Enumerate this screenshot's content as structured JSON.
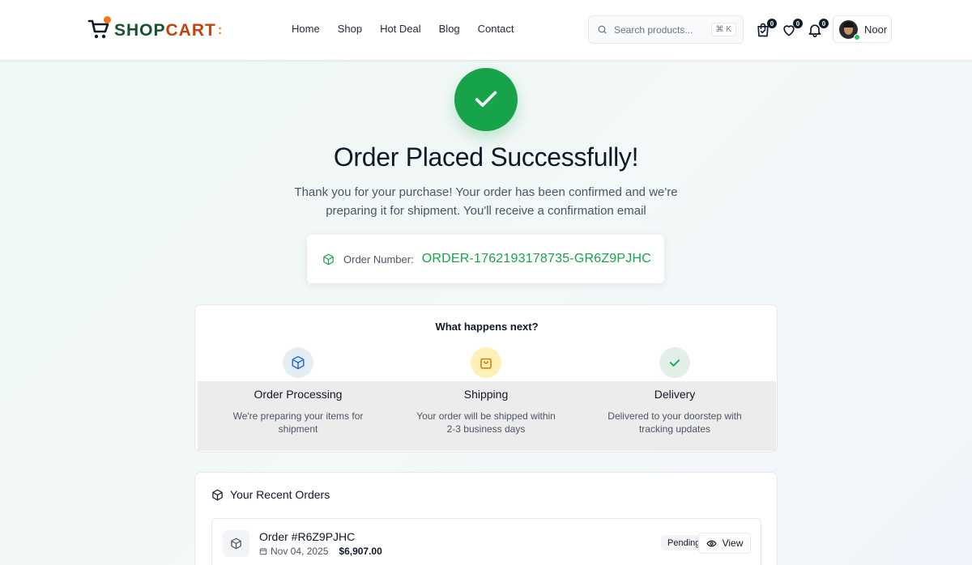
{
  "brand": {
    "name_part1": "SHOP",
    "name_part2": "CART",
    "colon": ":"
  },
  "nav": {
    "items": [
      "Home",
      "Shop",
      "Hot Deal",
      "Blog",
      "Contact"
    ]
  },
  "search": {
    "placeholder": "Search products...",
    "shortcut": "⌘ K"
  },
  "header_icons": {
    "cart_count": "0",
    "wishlist_count": "0",
    "notifications_count": "0"
  },
  "user": {
    "name": "Noor"
  },
  "hero": {
    "title": "Order Placed Successfully!",
    "subtitle": "Thank you for your purchase! Your order has been confirmed and we're preparing it for shipment. You'll receive a confirmation email",
    "order_number_label": "Order Number:",
    "order_number_value": "ORDER-1762193178735-GR6Z9PJHC"
  },
  "next_steps": {
    "title": "What happens next?",
    "steps": [
      {
        "title": "Order Processing",
        "description": "We're preparing your items for shipment",
        "icon": "package-icon",
        "color": "#2563eb",
        "bg": "#e3edf2"
      },
      {
        "title": "Shipping",
        "description": "Your order will be shipped within 2-3 business days",
        "icon": "shopping-bag-icon",
        "color": "#d97706",
        "bg": "#fdf1b8"
      },
      {
        "title": "Delivery",
        "description": "Delivered to your doorstep with tracking updates",
        "icon": "check-icon",
        "color": "#16a34a",
        "bg": "#e2efe9"
      }
    ]
  },
  "recent_orders": {
    "title": "Your Recent Orders",
    "orders": [
      {
        "id": "Order #R6Z9PJHC",
        "date": "Nov 04, 2025",
        "total": "$6,907.00",
        "status": "Pending",
        "action": "View"
      }
    ]
  },
  "colors": {
    "accent_green": "#16a34a",
    "logo_orange": "#c2410c",
    "logo_dark": "#14532d"
  }
}
